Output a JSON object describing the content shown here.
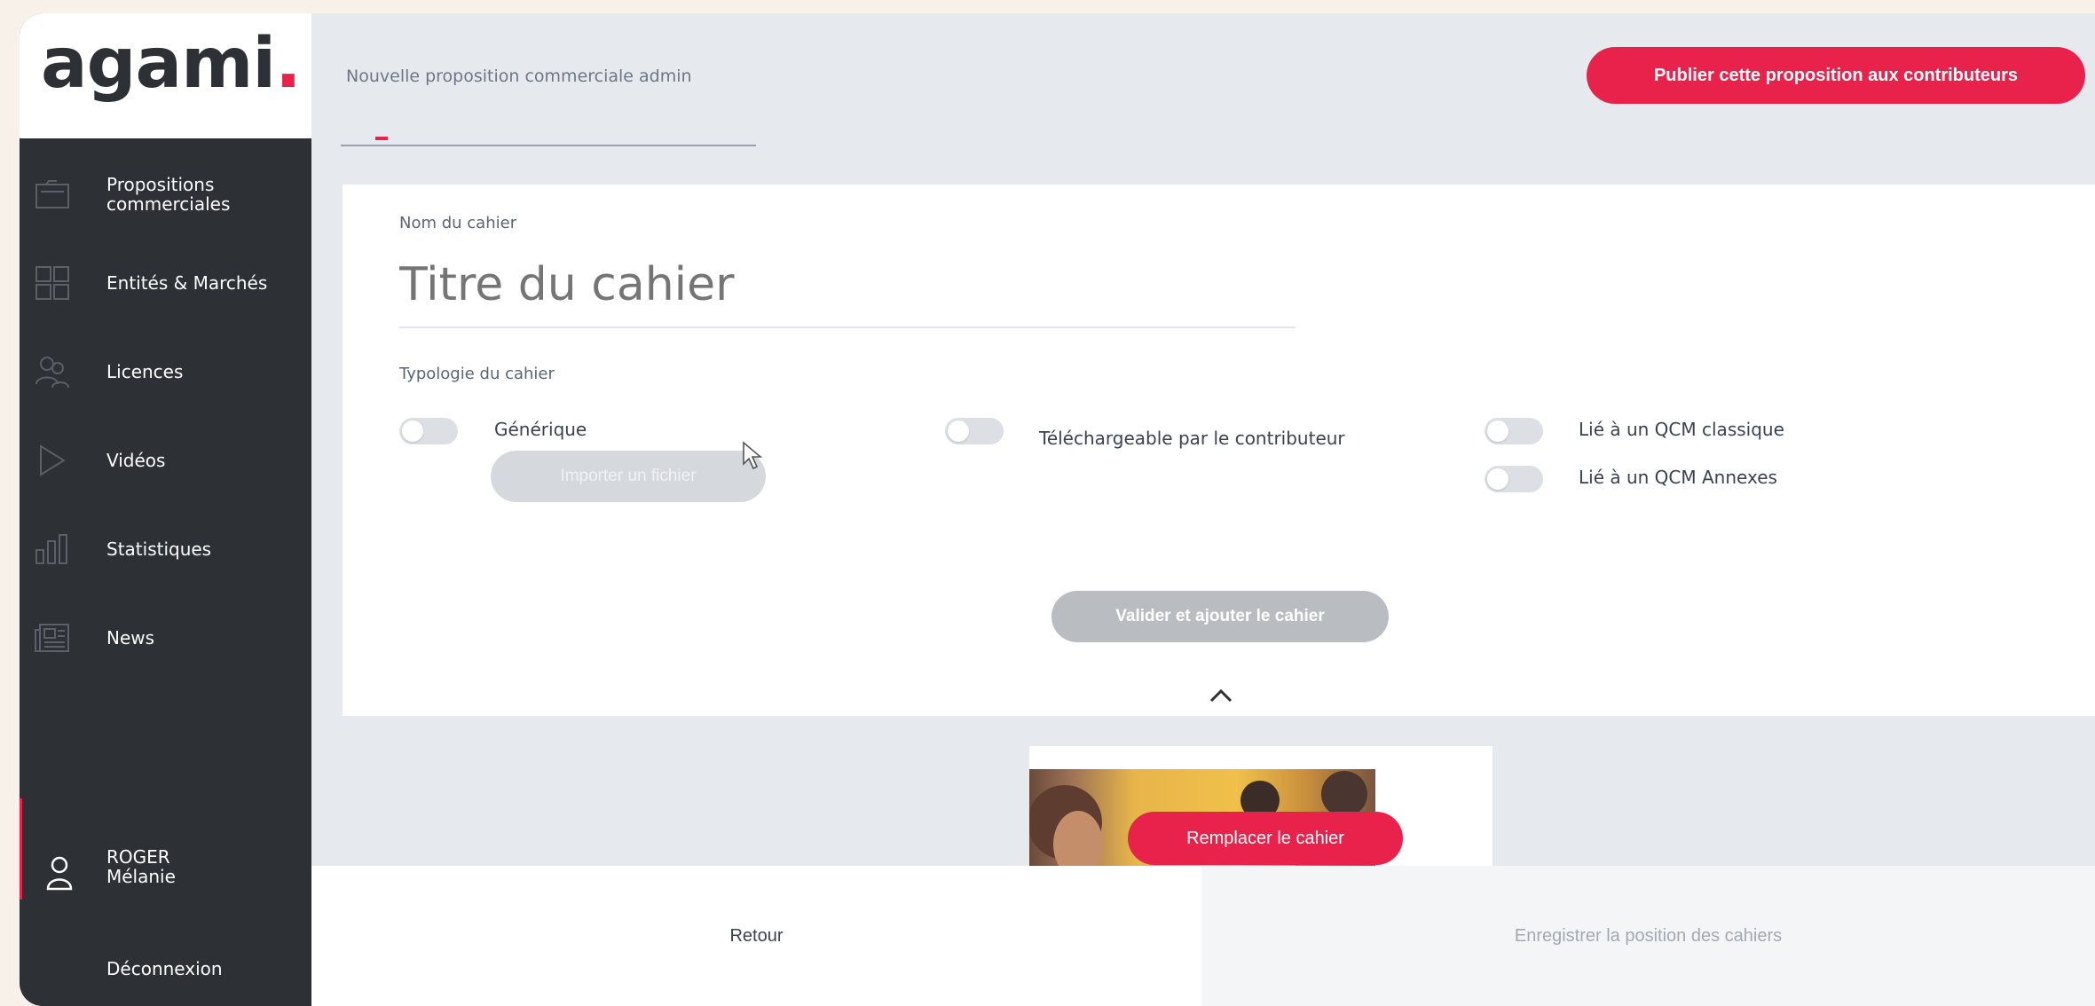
{
  "brand": {
    "logo_text": "agami",
    "logo_dot": ".",
    "accent": "#e8224a",
    "sidebar_bg": "#2d3035"
  },
  "sidebar": {
    "items": [
      {
        "label": "Propositions\ncommerciales",
        "icon": "folder-icon"
      },
      {
        "label": "Entités & Marchés",
        "icon": "grid-icon"
      },
      {
        "label": "Licences",
        "icon": "users-icon"
      },
      {
        "label": "Vidéos",
        "icon": "play-icon"
      },
      {
        "label": "Statistiques",
        "icon": "bar-chart-icon"
      },
      {
        "label": "News",
        "icon": "newspaper-icon"
      }
    ],
    "user": {
      "name": "ROGER\nMélanie",
      "icon": "user-icon"
    },
    "logout_label": "Déconnexion"
  },
  "header": {
    "title": "Nouvelle proposition commerciale admin",
    "publish_label": "Publier cette proposition aux contributeurs"
  },
  "form": {
    "name_label": "Nom du cahier",
    "name_placeholder": "Titre du cahier",
    "typology_label": "Typologie du cahier",
    "toggles": [
      {
        "label": "Générique",
        "on": false
      },
      {
        "label": "Téléchargeable par le contributeur",
        "on": false
      },
      {
        "label": "Lié à un QCM classique",
        "on": false
      },
      {
        "label": "Lié à un QCM Annexes",
        "on": false
      }
    ],
    "import_label": "Importer un fichier",
    "validate_label": "Valider et ajouter le cahier"
  },
  "preview": {
    "replace_label": "Remplacer le cahier"
  },
  "footer": {
    "back_label": "Retour",
    "save_label": "Enregistrer la position des cahiers"
  }
}
